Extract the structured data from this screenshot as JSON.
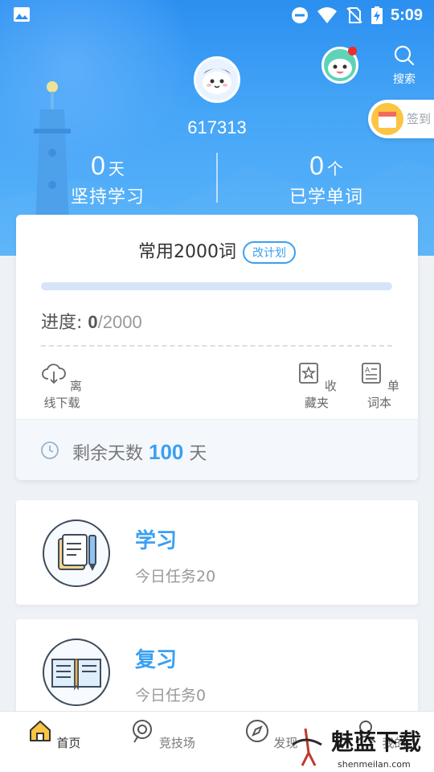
{
  "status_bar": {
    "time": "5:09",
    "icons": [
      "image-icon",
      "minus-circle-icon",
      "wifi-icon",
      "no-sim-icon",
      "battery-charging-icon"
    ]
  },
  "header": {
    "user_id": "617313",
    "search_label": "搜索",
    "checkin_label": "签到",
    "stats": [
      {
        "value": "0",
        "unit": "天",
        "label": "坚持学习"
      },
      {
        "value": "0",
        "unit": "个",
        "label": "已学单词"
      }
    ]
  },
  "plan": {
    "title": "常用2000词",
    "change_plan": "改计划",
    "progress_label": "进度:",
    "progress_current": "0",
    "progress_total": "/2000",
    "progress_fraction": 0,
    "tools": [
      {
        "label": "离线下载",
        "icon": "cloud-download-icon"
      },
      {
        "label": "收藏夹",
        "icon": "star-bookmark-icon"
      },
      {
        "label": "单词本",
        "icon": "vocabulary-book-icon"
      }
    ],
    "remaining_prefix": "剩余天数",
    "remaining_days": "100",
    "remaining_suffix": "天"
  },
  "tasks": [
    {
      "title": "学习",
      "subtitle": "今日任务20",
      "icon": "document-pen-icon"
    },
    {
      "title": "复习",
      "subtitle": "今日任务0",
      "icon": "open-book-icon"
    }
  ],
  "nav": [
    {
      "label": "首页",
      "icon": "home-icon",
      "active": true
    },
    {
      "label": "竞技场",
      "icon": "arena-icon",
      "active": false
    },
    {
      "label": "发现",
      "icon": "compass-icon",
      "active": false
    },
    {
      "label": "我的",
      "icon": "user-icon",
      "active": false
    }
  ],
  "watermark": {
    "text": "魅蓝下载",
    "url": "shenmeilan.com"
  },
  "colors": {
    "accent": "#3aa0f2",
    "header_top": "#2b8ff0",
    "badge": "#f02c2c"
  }
}
